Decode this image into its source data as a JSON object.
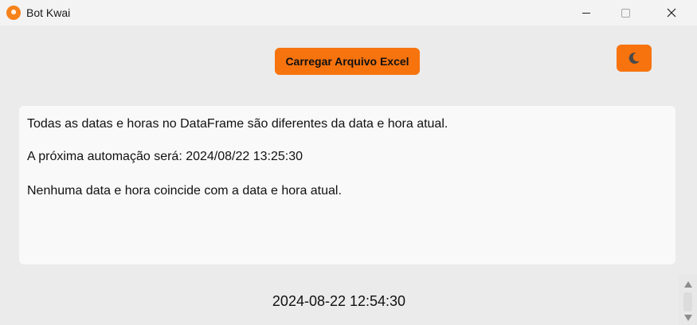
{
  "window": {
    "title": "Bot Kwai",
    "app_icon_glyph": "😸"
  },
  "toolbar": {
    "load_button_label": "Carregar Arquivo Excel",
    "theme_toggle_icon": "moon-icon"
  },
  "messages": [
    "Todas as datas e horas no DataFrame são diferentes da data e hora atual.",
    "A próxima automação será: 2024/08/22 13:25:30",
    "Nenhuma data e hora coincide com a data e hora atual."
  ],
  "clock": "2024-08-22 12:54:30",
  "colors": {
    "accent": "#f7730e",
    "background": "#ebebeb",
    "panel": "#f9f9f9",
    "titlebar": "#f3f3f3"
  }
}
